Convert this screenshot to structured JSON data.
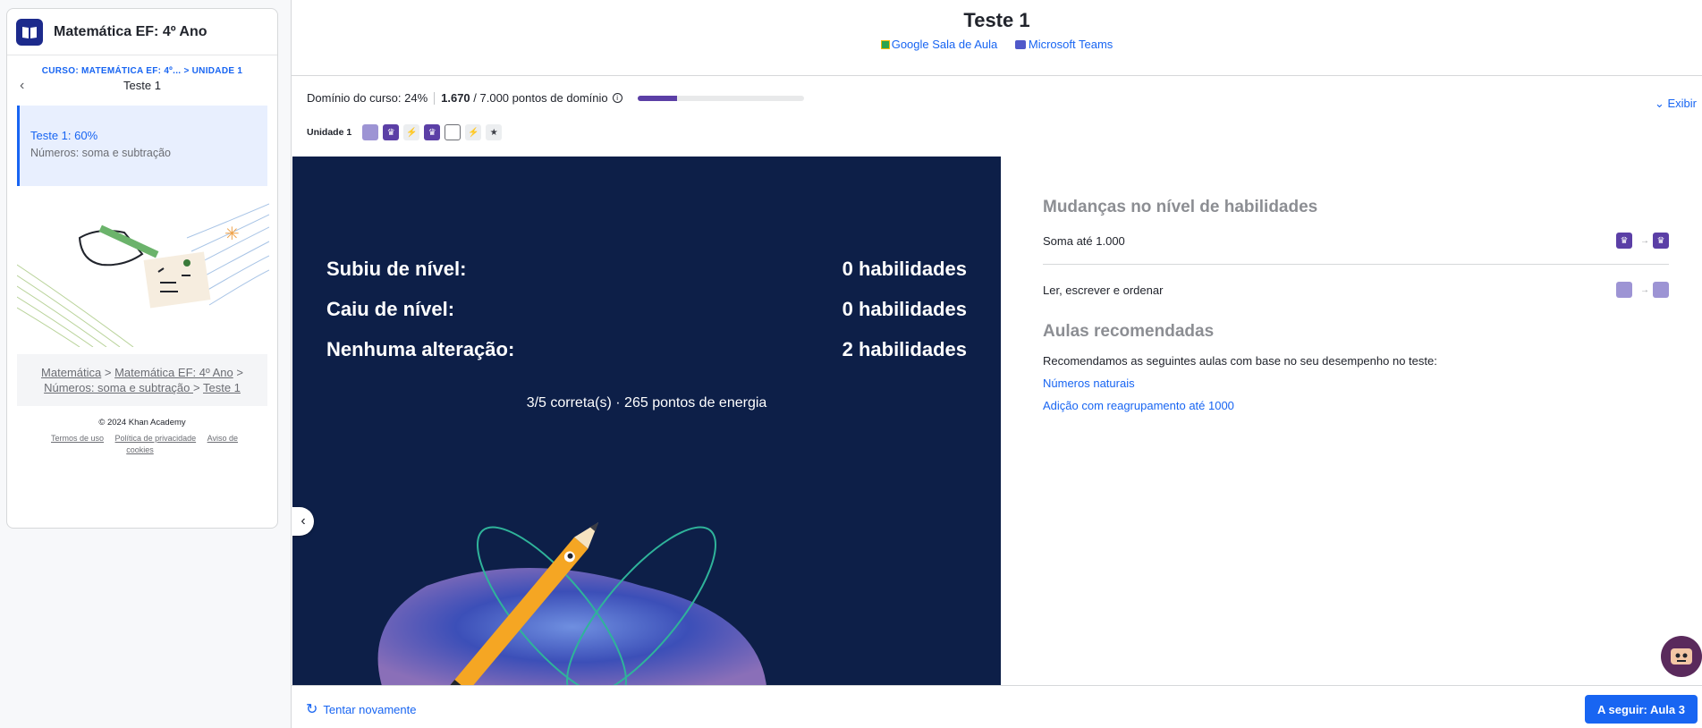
{
  "sidebar": {
    "course_title": "Matemática EF: 4º Ano",
    "crumb": "CURSO: MATEMÁTICA EF: 4º... > UNIDADE 1",
    "nav_title": "Teste 1",
    "item": {
      "title": "Teste 1: 60%",
      "subtitle": "Números: soma e subtração"
    },
    "breadcrumbs": [
      "Matemática",
      "Matemática EF: 4º Ano",
      "Números: soma e subtração ",
      "Teste 1"
    ],
    "breadcrumb_sep": ">",
    "copyright": "© 2024 Khan Academy",
    "links": [
      "Termos de uso",
      "Política de privacidade",
      "Aviso de cookies"
    ]
  },
  "header": {
    "title": "Teste 1",
    "google_classroom": "Google Sala de Aula",
    "microsoft_teams": "Microsoft Teams"
  },
  "mastery": {
    "label": "Domínio do curso: 24%",
    "points": "1.670",
    "total": " / 7.000 pontos de domínio",
    "progress_percent": 24,
    "expand_label": "Exibir",
    "unit_label": "Unidade 1",
    "unit_skills": [
      "familiar",
      "mastered",
      "quiz",
      "mastered",
      "attempted",
      "quiz",
      "unit-test"
    ]
  },
  "results": {
    "rows": [
      {
        "label": "Subiu de nível:",
        "value": "0 habilidades"
      },
      {
        "label": "Caiu de nível:",
        "value": "0 habilidades"
      },
      {
        "label": "Nenhuma alteração:",
        "value": "2 habilidades"
      }
    ],
    "summary": "3/5 correta(s) · 265 pontos de energia"
  },
  "skill_changes": {
    "title": "Mudanças no nível de habilidades",
    "items": [
      {
        "name": "Soma até 1.000",
        "from": "mastered",
        "to": "mastered"
      },
      {
        "name": "Ler, escrever e ordenar",
        "from": "familiar",
        "to": "familiar"
      }
    ]
  },
  "recommended": {
    "title": "Aulas recomendadas",
    "text": "Recomendamos as seguintes aulas com base no seu desempenho no teste:",
    "links": [
      "Números naturais",
      "Adição com reagrupamento até 1000"
    ]
  },
  "footer": {
    "retry_label": "Tentar novamente",
    "next_label": "A seguir: Aula 3"
  },
  "colors": {
    "accent": "#1865f2",
    "dark_panel": "#0d1f48",
    "mastered": "#5b3fa6",
    "familiar": "#9d94d4"
  }
}
